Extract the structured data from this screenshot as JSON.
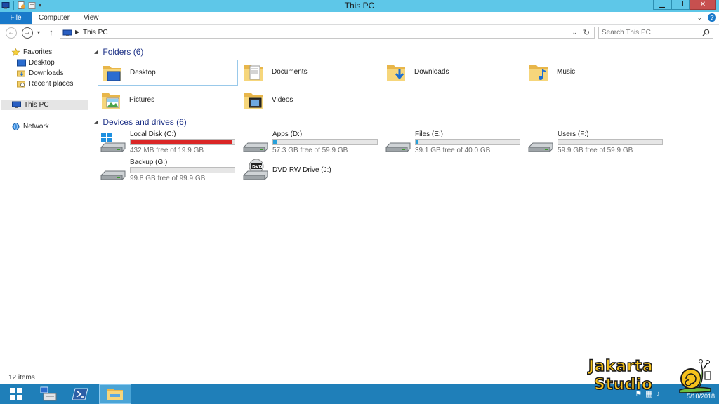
{
  "window": {
    "title": "This PC",
    "controls": {
      "minimize": "▁",
      "restore": "❐",
      "close": "✕"
    }
  },
  "ribbon": {
    "tabs": [
      "File",
      "Computer",
      "View"
    ]
  },
  "address": {
    "crumb": "This PC",
    "search_placeholder": "Search This PC"
  },
  "nav_pane": {
    "favorites": "Favorites",
    "favorite_items": [
      "Desktop",
      "Downloads",
      "Recent places"
    ],
    "this_pc": "This PC",
    "network": "Network"
  },
  "folders": {
    "header": "Folders (6)",
    "items": [
      "Desktop",
      "Documents",
      "Downloads",
      "Music",
      "Pictures",
      "Videos"
    ]
  },
  "drives": {
    "header": "Devices and drives (6)",
    "items": [
      {
        "name": "Local Disk (C:)",
        "free": "432 MB free of 19.9 GB",
        "used_fraction": 0.98
      },
      {
        "name": "Apps (D:)",
        "free": "57.3 GB free of 59.9 GB",
        "used_fraction": 0.04
      },
      {
        "name": "Files (E:)",
        "free": "39.1 GB free of 40.0 GB",
        "used_fraction": 0.02
      },
      {
        "name": "Users (F:)",
        "free": "59.9 GB free of 59.9 GB",
        "used_fraction": 0.0
      },
      {
        "name": "Backup (G:)",
        "free": "99.8 GB free of 99.9 GB",
        "used_fraction": 0.0
      },
      {
        "name": "DVD RW Drive (J:)",
        "free": "",
        "used_fraction": null
      }
    ]
  },
  "status": {
    "item_count": "12 items"
  },
  "taskbar": {
    "date": "5/10/2018"
  },
  "watermark": {
    "line1": "Jakarta",
    "line2": "Studio"
  },
  "colors": {
    "titlebar": "#5ec7e8",
    "file_tab": "#1979ca",
    "drive_bar_normal": "#26a0da",
    "drive_bar_full": "#da2626",
    "taskbar": "#1f7fb9",
    "section_header": "#1e3287"
  }
}
